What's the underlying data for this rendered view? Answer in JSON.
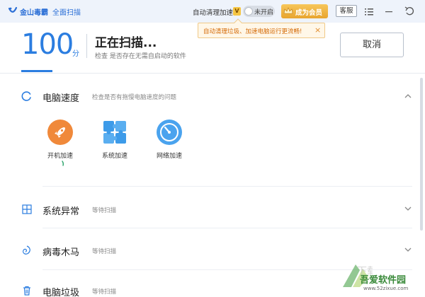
{
  "titlebar": {
    "app_name": "金山毒霸",
    "mode_name": "全面扫描",
    "auto_label": "自动清理加速",
    "v_badge": "V",
    "toggle_text": "未开启",
    "vip_label": "成为会员",
    "kefu_label": "客服"
  },
  "tooltip": {
    "text": "自动清理垃圾、加速电脑运行更流畅!",
    "close": "×"
  },
  "header": {
    "score": "100",
    "score_unit": "分",
    "title": "正在扫描...",
    "subtitle": "检查 是否存在无需自启动的软件",
    "cancel_label": "取消"
  },
  "sections": [
    {
      "title": "电脑速度",
      "status": "检查是否有拖慢电脑速度的问题",
      "expanded": true,
      "items": [
        {
          "label": "开机加速",
          "icon": "rocket-icon"
        },
        {
          "label": "系统加速",
          "icon": "puzzle-icon"
        },
        {
          "label": "网络加速",
          "icon": "gauge-icon"
        }
      ]
    },
    {
      "title": "系统异常",
      "status": "等待扫描",
      "expanded": false
    },
    {
      "title": "病毒木马",
      "status": "等待扫描",
      "expanded": false
    },
    {
      "title": "电脑垃圾",
      "status": "等待扫描",
      "expanded": false
    }
  ],
  "watermark": {
    "main": "吾爱软件园",
    "url": "www.52zixue.com"
  },
  "colors": {
    "accent": "#2b7de0",
    "vip": "#e8a52e",
    "tooltip_text": "#d46b08"
  }
}
